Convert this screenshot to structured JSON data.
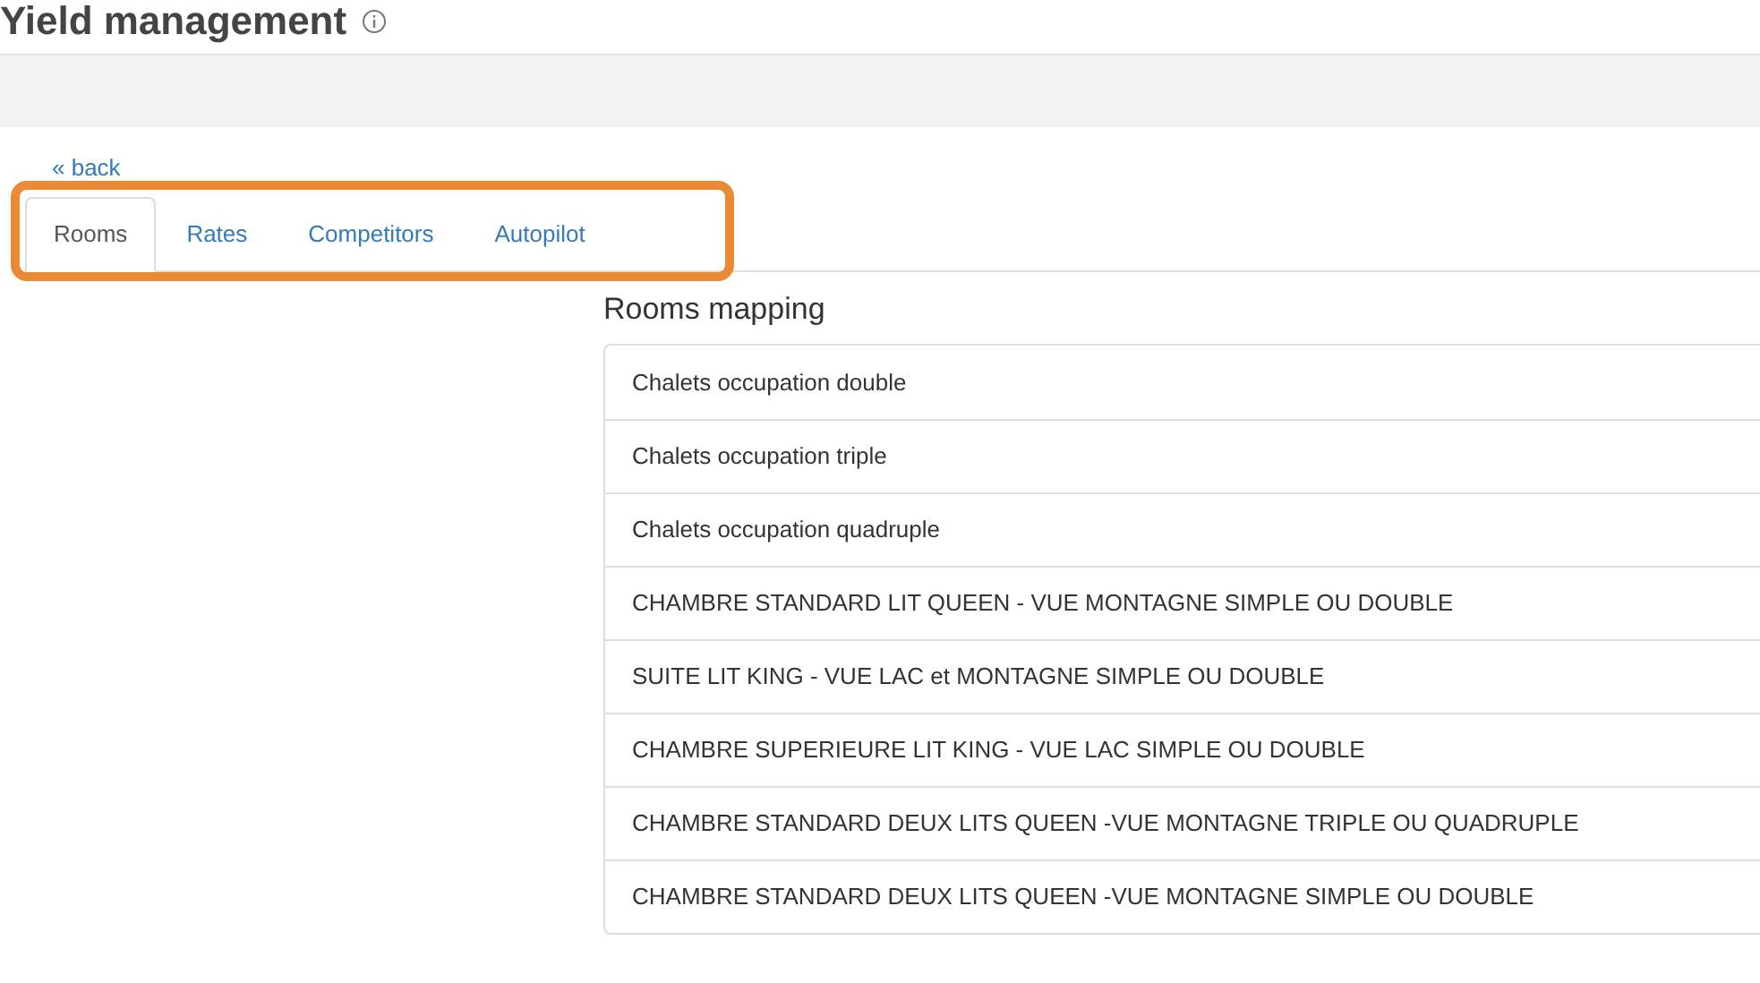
{
  "page": {
    "title": "Yield management"
  },
  "back_link": "« back",
  "tabs": [
    {
      "label": "Rooms",
      "selected": true
    },
    {
      "label": "Rates",
      "selected": false
    },
    {
      "label": "Competitors",
      "selected": false
    },
    {
      "label": "Autopilot",
      "selected": false
    }
  ],
  "rooms_mapping": {
    "heading": "Rooms mapping",
    "rows": [
      "Chalets occupation double",
      "Chalets occupation triple",
      "Chalets occupation quadruple",
      "CHAMBRE STANDARD LIT QUEEN - VUE MONTAGNE SIMPLE OU DOUBLE",
      "SUITE LIT KING - VUE LAC et MONTAGNE SIMPLE OU DOUBLE",
      "CHAMBRE SUPERIEURE LIT KING - VUE LAC SIMPLE OU DOUBLE",
      "CHAMBRE STANDARD DEUX LITS QUEEN -VUE MONTAGNE TRIPLE OU QUADRUPLE",
      "CHAMBRE STANDARD DEUX LITS QUEEN -VUE MONTAGNE SIMPLE OU DOUBLE"
    ]
  }
}
